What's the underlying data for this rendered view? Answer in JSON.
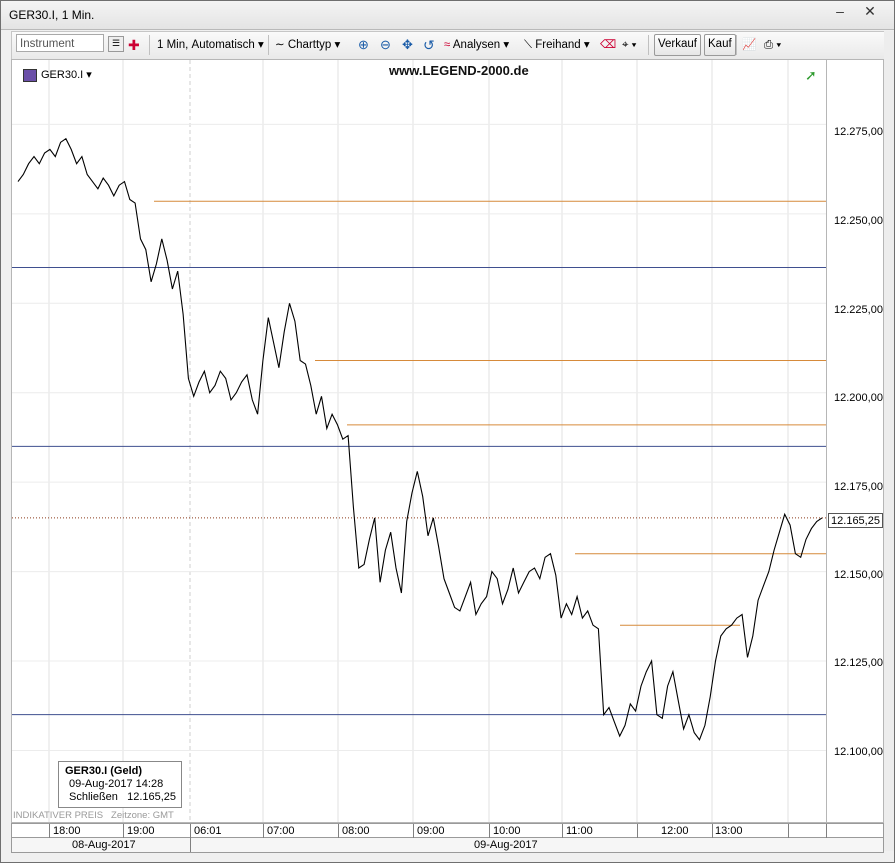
{
  "window": {
    "title": "GER30.I, 1 Min."
  },
  "toolbar": {
    "instrument_placeholder": "Instrument",
    "interval_label": "1 Min,",
    "interval_mode": "Automatisch",
    "charttype_label": "Charttyp",
    "analysen_label": "Analysen",
    "freihand_label": "Freihand",
    "sell_label": "Verkauf",
    "buy_label": "Kauf"
  },
  "chart": {
    "instrument_label": "GER30.I",
    "watermark": "www.LEGEND-2000.de",
    "current_price": "12.165,25",
    "y_ticks": [
      "12.275,00",
      "12.250,00",
      "12.225,00",
      "12.200,00",
      "12.175,00",
      "12.150,00",
      "12.125,00",
      "12.100,00"
    ],
    "x_ticks": [
      "18:00",
      "19:00",
      "06:01",
      "07:00",
      "08:00",
      "09:00",
      "10:00",
      "11:00",
      "12:00",
      "13:00"
    ],
    "date_labels": [
      "08-Aug-2017",
      "09-Aug-2017"
    ],
    "indikativer_preis": "INDIKATIVER PREIS",
    "zeitzone": "Zeitzone: GMT"
  },
  "infobox": {
    "title": "GER30.I (Geld)",
    "date": "09-Aug-2017 14:28",
    "close_label": "Schließen",
    "close_value": "12.165,25"
  },
  "colors": {
    "price_line": "#000000",
    "horizontal_blue": "#3f4f8f",
    "horizontal_orange": "#d68a3a",
    "current_price_dotted": "#8b3a1a"
  },
  "chart_data": {
    "type": "line",
    "ylim": [
      12080,
      12293
    ],
    "x_labels": [
      "18:00",
      "19:00",
      "06:01",
      "07:00",
      "08:00",
      "09:00",
      "10:00",
      "11:00",
      "12:00",
      "13:00"
    ],
    "series": [
      {
        "values": [
          12259,
          12261,
          12264,
          12266,
          12264,
          12267,
          12268,
          12266,
          12270,
          12271,
          12268,
          12264,
          12266,
          12261,
          12259,
          12257,
          12260,
          12258,
          12255,
          12258,
          12259,
          12254,
          12253,
          12243,
          12240,
          12231,
          12236,
          12243,
          12237,
          12229,
          12234,
          12222,
          12204,
          12199,
          12203,
          12206,
          12200,
          12202,
          12206,
          12204,
          12198,
          12200,
          12203,
          12205,
          12198,
          12194,
          12209,
          12221,
          12214,
          12207,
          12217,
          12225,
          12220,
          12209,
          12208,
          12202,
          12194,
          12199,
          12190,
          12194,
          12191,
          12187,
          12188,
          12168,
          12151,
          12152,
          12159,
          12165,
          12147,
          12156,
          12161,
          12151,
          12144,
          12164,
          12172,
          12178,
          12171,
          12160,
          12165,
          12157,
          12148,
          12144,
          12140,
          12139,
          12143,
          12147,
          12138,
          12141,
          12143,
          12150,
          12148,
          12141,
          12145,
          12151,
          12144,
          12147,
          12150,
          12151,
          12148,
          12154,
          12155,
          12149,
          12137,
          12141,
          12138,
          12143,
          12137,
          12139,
          12135,
          12134,
          12110,
          12112,
          12108,
          12104,
          12107,
          12113,
          12111,
          12118,
          12122,
          12125,
          12110,
          12109,
          12118,
          12122,
          12114,
          12106,
          12110,
          12105,
          12103,
          12107,
          12115,
          12125,
          12132,
          12134,
          12135,
          12137,
          12138,
          12126,
          12132,
          12142,
          12146,
          12150,
          12156,
          12161,
          12166,
          12163,
          12155,
          12154,
          12159,
          12162,
          12164,
          12165
        ]
      }
    ],
    "horizontal_lines": [
      {
        "value": 12235,
        "color": "blue"
      },
      {
        "value": 12185,
        "color": "blue"
      },
      {
        "value": 12110,
        "color": "blue"
      },
      {
        "value": 12253.5,
        "color": "orange"
      },
      {
        "value": 12209,
        "color": "orange"
      },
      {
        "value": 12191,
        "color": "orange"
      },
      {
        "value": 12155,
        "color": "orange"
      },
      {
        "value": 12135,
        "color": "orange"
      }
    ]
  }
}
